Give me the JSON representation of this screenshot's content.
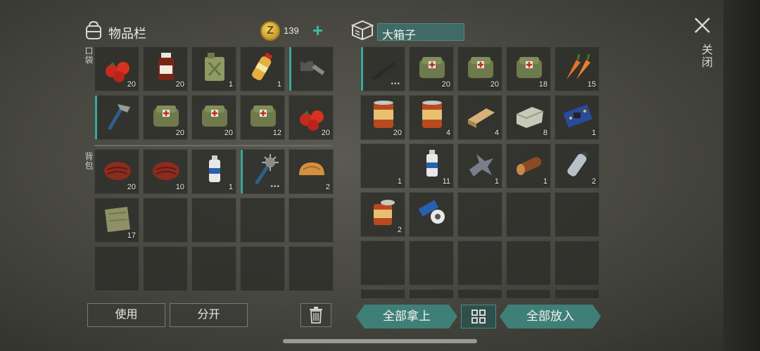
{
  "header": {
    "inventory_title": "物品栏",
    "coin_symbol": "Z",
    "coin_count": "139",
    "add_symbol": "+",
    "box_name": "大箱子",
    "close_label": "关闭"
  },
  "sections": {
    "pocket_label": "口袋",
    "backpack_label": "背包"
  },
  "pocket": [
    {
      "icon": "tomatoes-icon",
      "qty": "20"
    },
    {
      "icon": "medicine-bottle-icon",
      "qty": "20"
    },
    {
      "icon": "jerrycan-icon",
      "qty": "1"
    },
    {
      "icon": "water-bottle-icon",
      "qty": "1"
    },
    {
      "icon": "chainsaw-icon",
      "qty": "",
      "selected": true
    },
    {
      "icon": "hatchet-icon",
      "qty": "",
      "selected": true
    },
    {
      "icon": "medkit-bag-icon",
      "qty": "20"
    },
    {
      "icon": "medkit-bag-icon",
      "qty": "20"
    },
    {
      "icon": "medkit-bag-icon",
      "qty": "12"
    },
    {
      "icon": "tomatoes-icon",
      "qty": "20"
    }
  ],
  "backpack": [
    {
      "icon": "steak-icon",
      "qty": "20"
    },
    {
      "icon": "steak-icon",
      "qty": "10"
    },
    {
      "icon": "spray-can-icon",
      "qty": "1"
    },
    {
      "icon": "spiked-club-icon",
      "qty": "",
      "selected": true,
      "dots": "•••"
    },
    {
      "icon": "bread-icon",
      "qty": "2"
    },
    {
      "icon": "cloth-icon",
      "qty": "17"
    },
    {
      "icon": "",
      "qty": ""
    },
    {
      "icon": "",
      "qty": ""
    },
    {
      "icon": "",
      "qty": ""
    },
    {
      "icon": "",
      "qty": ""
    },
    {
      "icon": "",
      "qty": ""
    },
    {
      "icon": "",
      "qty": ""
    },
    {
      "icon": "",
      "qty": ""
    },
    {
      "icon": "",
      "qty": ""
    },
    {
      "icon": "",
      "qty": ""
    }
  ],
  "box": [
    {
      "icon": "rifle-icon",
      "qty": "",
      "selected": true,
      "dots": "•••"
    },
    {
      "icon": "medkit-bag-icon",
      "qty": "20"
    },
    {
      "icon": "medkit-bag-icon",
      "qty": "20"
    },
    {
      "icon": "medkit-bag-icon",
      "qty": "18"
    },
    {
      "icon": "carrot-icon",
      "qty": "15"
    },
    {
      "icon": "canned-food-icon",
      "qty": "20"
    },
    {
      "icon": "canned-food-icon",
      "qty": "4"
    },
    {
      "icon": "wood-plank-icon",
      "qty": "4"
    },
    {
      "icon": "stone-block-icon",
      "qty": "8"
    },
    {
      "icon": "circuit-board-icon",
      "qty": "1"
    },
    {
      "icon": "spring-icon",
      "qty": "1"
    },
    {
      "icon": "spray-can-icon",
      "qty": "11"
    },
    {
      "icon": "metal-scrap-icon",
      "qty": "1"
    },
    {
      "icon": "log-icon",
      "qty": "1"
    },
    {
      "icon": "plastic-bottle-icon",
      "qty": "2"
    },
    {
      "icon": "open-can-icon",
      "qty": "2"
    },
    {
      "icon": "tape-roll-icon",
      "qty": ""
    },
    {
      "icon": "",
      "qty": ""
    },
    {
      "icon": "",
      "qty": ""
    },
    {
      "icon": "",
      "qty": ""
    },
    {
      "icon": "",
      "qty": ""
    },
    {
      "icon": "",
      "qty": ""
    },
    {
      "icon": "",
      "qty": ""
    },
    {
      "icon": "",
      "qty": ""
    },
    {
      "icon": "",
      "qty": ""
    },
    {
      "icon": "",
      "qty": ""
    },
    {
      "icon": "",
      "qty": ""
    },
    {
      "icon": "",
      "qty": ""
    },
    {
      "icon": "",
      "qty": ""
    },
    {
      "icon": "",
      "qty": ""
    }
  ],
  "buttons": {
    "use": "使用",
    "split": "分开",
    "take_all": "全部拿上",
    "put_all": "全部放入"
  },
  "colors": {
    "accent": "#3e7f78",
    "selected_marker": "#3aa89a",
    "coin": "#e2b844"
  }
}
